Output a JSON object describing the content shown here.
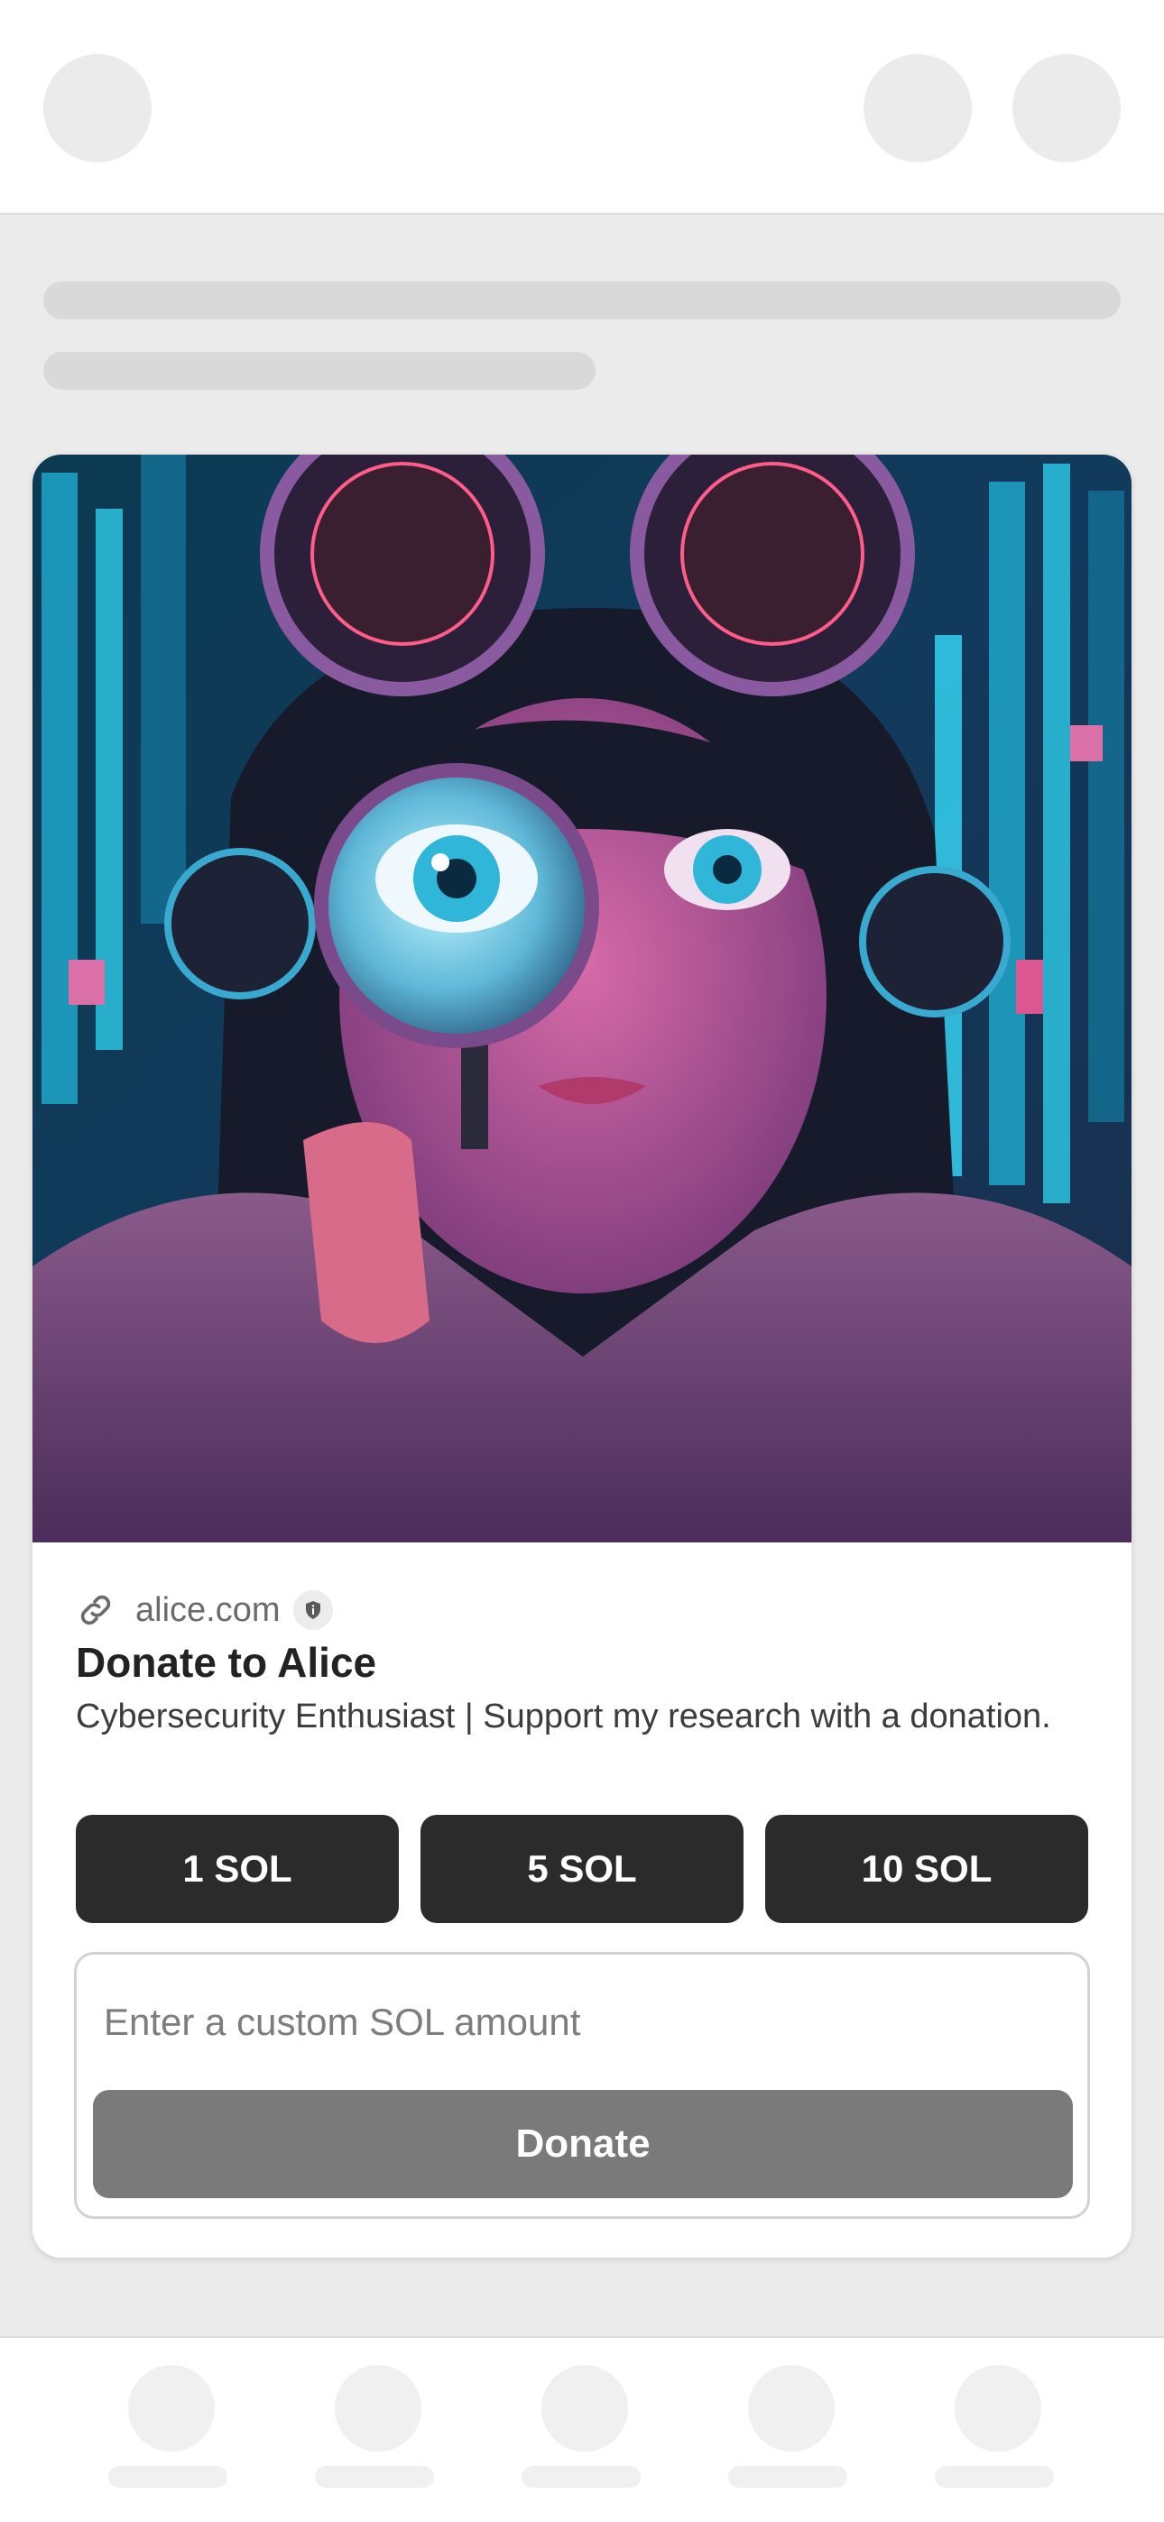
{
  "card": {
    "domain": "alice.com",
    "title": "Donate to Alice",
    "description": "Cybersecurity Enthusiast | Support my research with a donation.",
    "amount_options": [
      "1 SOL",
      "5 SOL",
      "10 SOL"
    ],
    "custom_amount": {
      "placeholder": "Enter a custom SOL amount",
      "value": ""
    },
    "donate_label": "Donate"
  },
  "icons": {
    "link": "link-icon",
    "verified": "shield-icon",
    "hero": "cyberpunk-girl-with-magnifying-glass"
  },
  "colors": {
    "button_dark": "#2b2b2b",
    "donate_disabled": "#7a7a7a",
    "background": "#ebebeb"
  }
}
